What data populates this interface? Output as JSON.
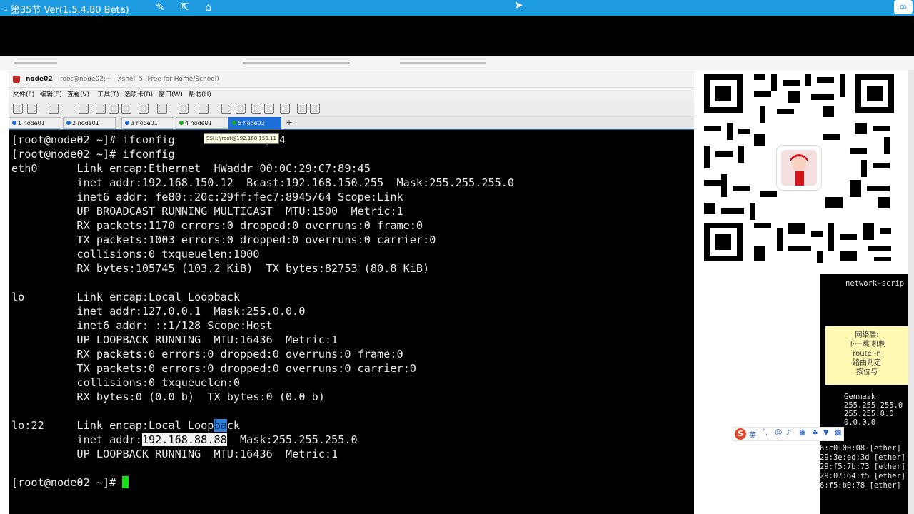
{
  "outer": {
    "title": "- 第35节 Ver(1.5.4.80 Beta)",
    "accent": "#1e9be0"
  },
  "xshell": {
    "window_name": "node02",
    "window_subtitle": "root@node02:~ - Xshell 5 (Free for Home/School)",
    "menu": [
      "文件(F)",
      "编辑(E)",
      "查看(V)",
      "工具(T)",
      "选项卡(B)",
      "窗口(W)",
      "帮助(H)"
    ],
    "tabs": [
      {
        "label": "1 node01",
        "dot": "#1e6fd9"
      },
      {
        "label": "2 node01",
        "dot": "#1e6fd9"
      },
      {
        "label": "3 node01",
        "dot": "#1e6fd9"
      },
      {
        "label": "4 node01",
        "dot": "#22a822"
      },
      {
        "label": "5 node02",
        "dot": "#22a822"
      }
    ],
    "tab_add": "+",
    "tooltip": "SSH://root@192.168.150.11"
  },
  "terminal": {
    "line1_prompt": "[root@node02 ~]# ifconfig",
    "line1_tail": ".88.88/24",
    "line2": "[root@node02 ~]# ifconfig",
    "eth0": [
      "eth0      Link encap:Ethernet  HWaddr 00:0C:29:C7:89:45",
      "          inet addr:192.168.150.12  Bcast:192.168.150.255  Mask:255.255.255.0",
      "          inet6 addr: fe80::20c:29ff:fec7:8945/64 Scope:Link",
      "          UP BROADCAST RUNNING MULTICAST  MTU:1500  Metric:1",
      "          RX packets:1170 errors:0 dropped:0 overruns:0 frame:0",
      "          TX packets:1003 errors:0 dropped:0 overruns:0 carrier:0",
      "          collisions:0 txqueuelen:1000",
      "          RX bytes:105745 (103.2 KiB)  TX bytes:82753 (80.8 KiB)"
    ],
    "lo": [
      "lo        Link encap:Local Loopback",
      "          inet addr:127.0.0.1  Mask:255.0.0.0",
      "          inet6 addr: ::1/128 Scope:Host",
      "          UP LOOPBACK RUNNING  MTU:16436  Metric:1",
      "          RX packets:0 errors:0 dropped:0 overruns:0 frame:0",
      "          TX packets:0 errors:0 dropped:0 overruns:0 carrier:0",
      "          collisions:0 txqueuelen:0",
      "          RX bytes:0 (0.0 b)  TX bytes:0 (0.0 b)"
    ],
    "lo22_a": "lo:22     Link encap:Local Loop",
    "lo22_sel": "ba",
    "lo22_b": "ck",
    "lo22_inet_pre": "          inet addr:",
    "lo22_inet_sel": "192.168.88.88",
    "lo22_inet_post": "  Mask:255.255.255.0",
    "lo22_up": "          UP LOOPBACK RUNNING  MTU:16436  Metric:1",
    "final_prompt": "[root@node02 ~]# "
  },
  "right": {
    "script_text": "network-scrip",
    "sticky_lines": [
      "网络层:",
      "下一跳 机制",
      "route -n",
      "路由判定",
      "按位与"
    ],
    "genmask_lines": [
      "Genmask",
      "255.255.255.0",
      "255.255.0.0",
      "0.0.0.0"
    ],
    "arp_lines": [
      "6:c0:00:08 [ether]",
      "29:3e:ed:3d [ether]",
      "29:f5:7b:73 [ether]",
      "29:07:64:f5 [ether]",
      "6:f5:b0:78 [ether]"
    ],
    "ime_logo": "S",
    "ime_text": "英"
  }
}
